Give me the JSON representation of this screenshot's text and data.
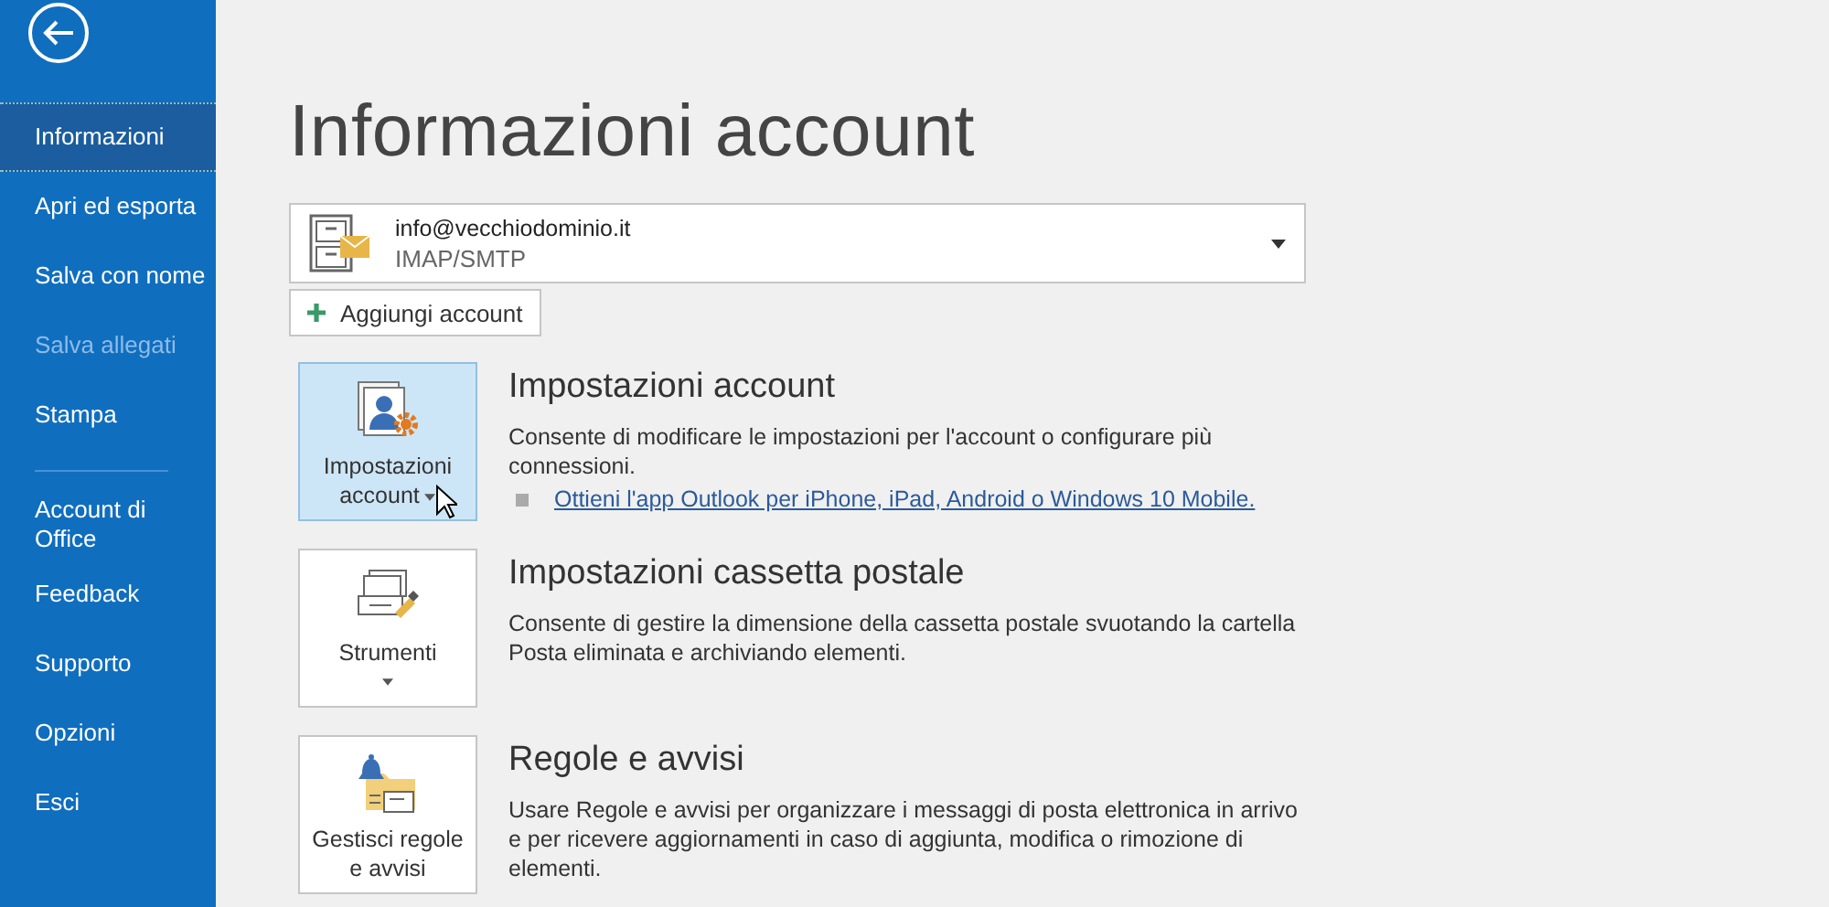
{
  "sidebar": {
    "items": [
      {
        "label": "Informazioni",
        "selected": true,
        "disabled": false,
        "divider_before": false
      },
      {
        "label": "Apri ed esporta",
        "selected": false,
        "disabled": false,
        "divider_before": false
      },
      {
        "label": "Salva con nome",
        "selected": false,
        "disabled": false,
        "divider_before": false
      },
      {
        "label": "Salva allegati",
        "selected": false,
        "disabled": true,
        "divider_before": false
      },
      {
        "label": "Stampa",
        "selected": false,
        "disabled": false,
        "divider_before": false
      },
      {
        "label": "Account di Office",
        "selected": false,
        "disabled": false,
        "divider_before": true
      },
      {
        "label": "Feedback",
        "selected": false,
        "disabled": false,
        "divider_before": false
      },
      {
        "label": "Supporto",
        "selected": false,
        "disabled": false,
        "divider_before": false
      },
      {
        "label": "Opzioni",
        "selected": false,
        "disabled": false,
        "divider_before": false
      },
      {
        "label": "Esci",
        "selected": false,
        "disabled": false,
        "divider_before": false
      }
    ]
  },
  "title": "Informazioni account",
  "account": {
    "email": "info@vecchiodominio.it",
    "type": "IMAP/SMTP"
  },
  "add_account": "Aggiungi account",
  "sections": [
    {
      "kind": "account",
      "tile": "Impostazioni account",
      "has_menu": true,
      "selected": true,
      "heading": "Impostazioni account",
      "description": "Consente di modificare le impostazioni per l'account o configurare più connessioni.",
      "link": "Ottieni l'app Outlook per iPhone, iPad, Android o Windows 10 Mobile."
    },
    {
      "kind": "tools",
      "tile": "Strumenti",
      "has_menu": true,
      "selected": false,
      "heading": "Impostazioni cassetta postale",
      "description": "Consente di gestire la dimensione della cassetta postale svuotando la cartella Posta eliminata e archiviando elementi."
    },
    {
      "kind": "rules",
      "tile": "Gestisci regole e avvisi",
      "has_menu": false,
      "selected": false,
      "heading": "Regole e avvisi",
      "description": "Usare Regole e avvisi per organizzare i messaggi di posta elettronica in arrivo e per ricevere aggiornamenti in caso di aggiunta, modifica o rimozione di elementi."
    }
  ]
}
